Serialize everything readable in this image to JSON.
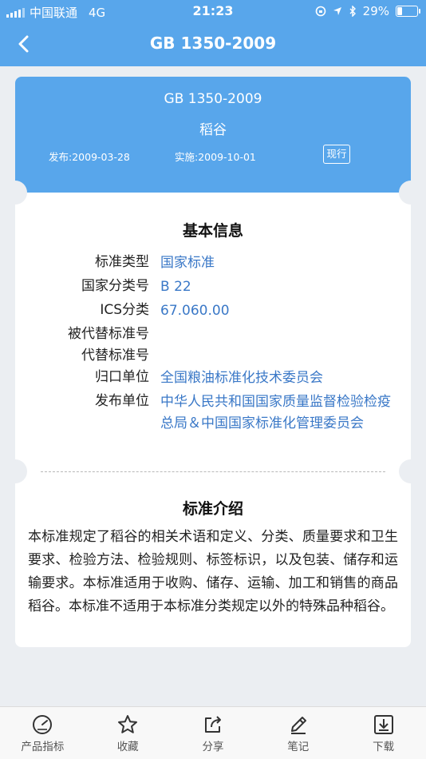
{
  "status": {
    "carrier": "中国联通",
    "network": "4G",
    "time": "21:23",
    "battery": "29%",
    "battery_level": 0.29
  },
  "header": {
    "title": "GB 1350-2009",
    "back_icon": "chevron-left-icon"
  },
  "standard": {
    "code": "GB 1350-2009",
    "name": "稻谷",
    "publish_date": "发布:2009-03-28",
    "implement_date": "实施:2009-10-01",
    "status_badge": "现行"
  },
  "basic_info": {
    "title": "基本信息",
    "rows": [
      {
        "label": "标准类型",
        "value": "国家标准"
      },
      {
        "label": "国家分类号",
        "value": "B 22"
      },
      {
        "label": "ICS分类",
        "value": "67.060.00"
      },
      {
        "label": "被代替标准号",
        "value": ""
      },
      {
        "label": "代替标准号",
        "value": ""
      },
      {
        "label": "归口单位",
        "value": "全国粮油标准化技术委员会"
      },
      {
        "label": "发布单位",
        "value": "中华人民共和国国家质量监督检验检疫总局＆中国国家标准化管理委员会"
      }
    ]
  },
  "intro": {
    "title": "标准介绍",
    "text": "本标准规定了稻谷的相关术语和定义、分类、质量要求和卫生要求、检验方法、检验规则、标签标识，以及包装、储存和运输要求。本标准适用于收购、储存、运输、加工和销售的商品稻谷。本标准不适用于本标准分类规定以外的特殊品种稻谷。"
  },
  "tabbar": [
    {
      "label": "产品指标",
      "icon": "gauge-icon"
    },
    {
      "label": "收藏",
      "icon": "star-icon"
    },
    {
      "label": "分享",
      "icon": "share-icon"
    },
    {
      "label": "笔记",
      "icon": "pencil-icon"
    },
    {
      "label": "下载",
      "icon": "download-icon"
    }
  ],
  "colors": {
    "primary": "#58a6eb",
    "link": "#3a78c7",
    "background": "#ebeef2"
  }
}
